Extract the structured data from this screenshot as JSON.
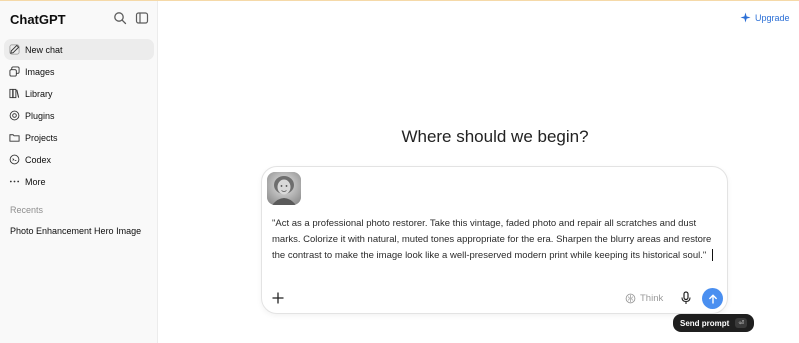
{
  "sidebar": {
    "brand": "ChatGPT",
    "items": [
      {
        "label": "New chat",
        "icon": "edit-icon"
      },
      {
        "label": "Images",
        "icon": "images-icon"
      },
      {
        "label": "Library",
        "icon": "library-icon"
      },
      {
        "label": "Plugins",
        "icon": "plugins-icon"
      },
      {
        "label": "Projects",
        "icon": "folder-icon"
      },
      {
        "label": "Codex",
        "icon": "codex-icon"
      },
      {
        "label": "More",
        "icon": "more-icon"
      }
    ],
    "recents_title": "Recents",
    "recents": [
      "Photo Enhancement Hero Image"
    ]
  },
  "header": {
    "upgrade_label": "Upgrade",
    "accent": "#2b6fd6"
  },
  "main": {
    "heading": "Where should we begin?"
  },
  "composer": {
    "prompt": "\"Act as a professional photo restorer. Take this vintage, faded photo and repair all scratches and dust marks. Colorize it with natural, muted tones appropriate for the era. Sharpen the blurry areas and restore the contrast to make the image look like a well-preserved modern print while keeping its historical soul.\"",
    "think_label": "Think",
    "send_color": "#4a8ff0"
  },
  "tooltip": {
    "label": "Send prompt",
    "shortcut": "⏎"
  }
}
